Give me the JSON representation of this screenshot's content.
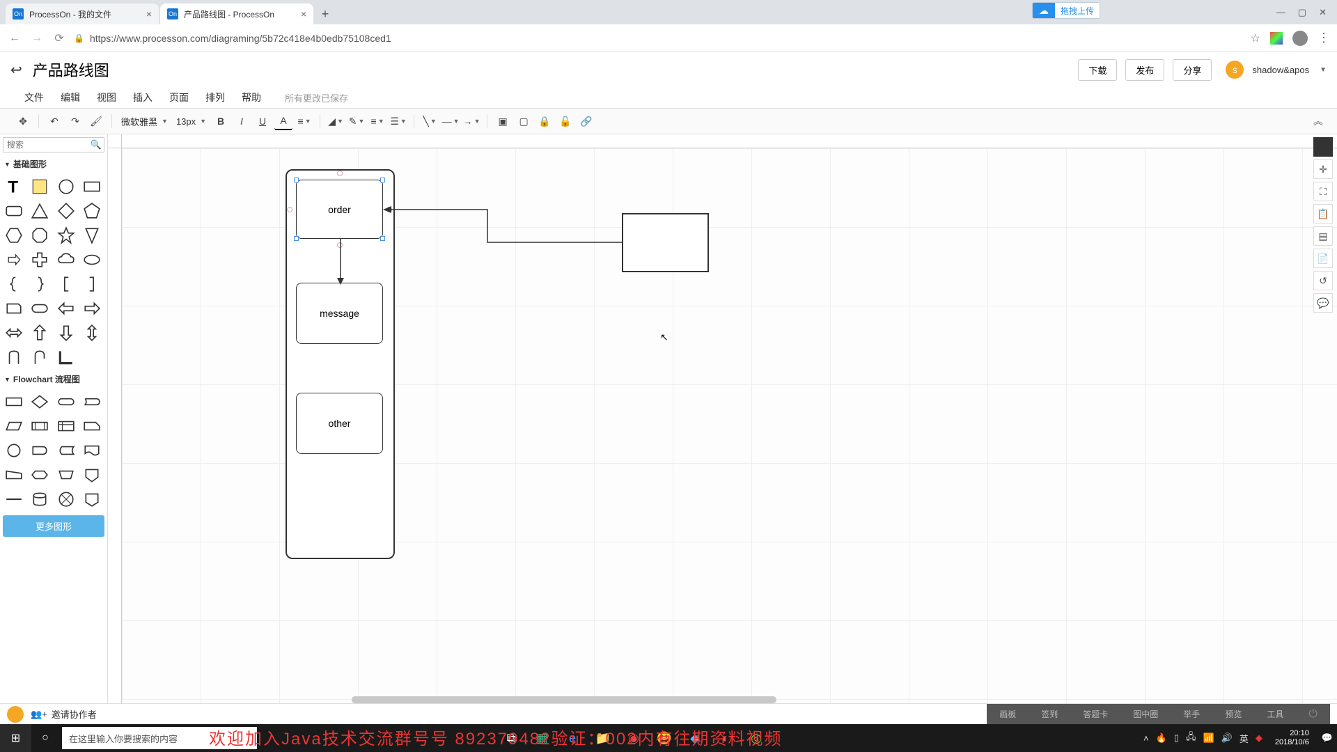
{
  "browser": {
    "tabs": [
      {
        "icon": "On",
        "title": "ProcessOn - 我的文件"
      },
      {
        "icon": "On",
        "title": "产品路线图 - ProcessOn"
      }
    ],
    "url": "https://www.processon.com/diagraming/5b72c418e4b0edb75108ced1",
    "ext_badge": "拖拽上传"
  },
  "app": {
    "back_icon": "↩",
    "title": "产品路线图",
    "btn_download": "下载",
    "btn_publish": "发布",
    "btn_share": "分享",
    "avatar_letter": "s",
    "username": "shadow&apos"
  },
  "menu": {
    "items": [
      "文件",
      "编辑",
      "视图",
      "插入",
      "页面",
      "排列",
      "帮助"
    ],
    "save_status": "所有更改已保存"
  },
  "toolbar": {
    "font_name": "微软雅黑",
    "font_size": "13px"
  },
  "sidebar": {
    "search_placeholder": "搜索",
    "group_basic": "基础图形",
    "group_flowchart": "Flowchart 流程图",
    "more_shapes": "更多图形"
  },
  "canvas": {
    "nodes": {
      "order": "order",
      "message": "message",
      "other": "other"
    }
  },
  "bottom": {
    "invite": "邀请协作者",
    "tabs": [
      "画板",
      "签到",
      "答题卡",
      "图中圈",
      "举手",
      "预览",
      "工具"
    ]
  },
  "taskbar": {
    "search_placeholder": "在这里输入你要搜索的内容",
    "overlay": "欢迎加入Java技术交流群号号 892379482验证：002内有往期资料视频",
    "time": "20:10",
    "date": "2018/10/6",
    "ime": "英"
  }
}
